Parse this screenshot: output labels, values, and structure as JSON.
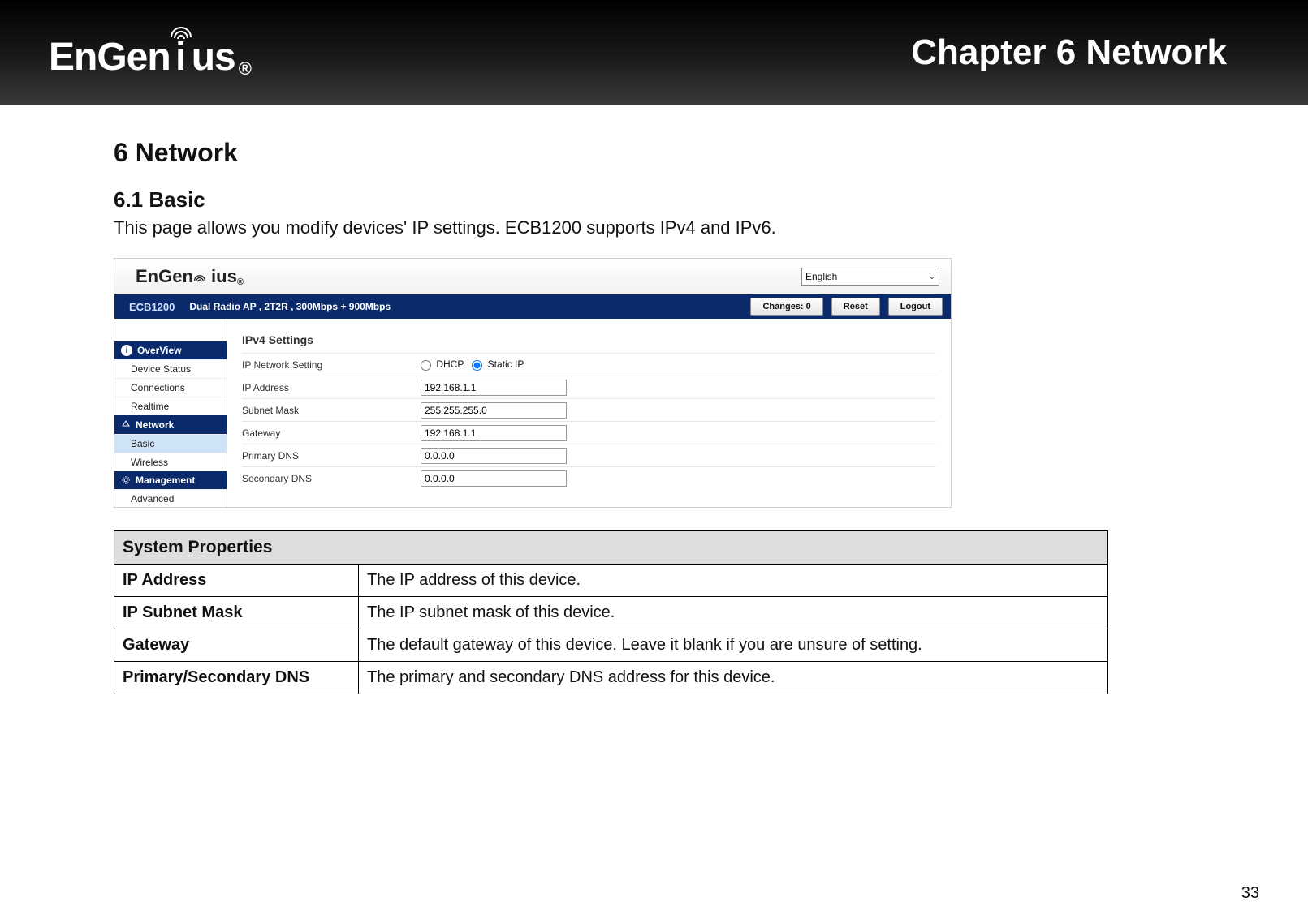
{
  "header": {
    "brand": "EnGenius",
    "registered": "®",
    "chapter_title": "Chapter 6 Network"
  },
  "doc": {
    "section_number_title": "6   Network",
    "subsection_title": "6.1   Basic",
    "lead_text": "This page allows you modify devices' IP settings. ECB1200 supports IPv4 and IPv6.",
    "page_number": "33"
  },
  "ui": {
    "brand": "EnGenius",
    "registered": "®",
    "language": "English",
    "model": "ECB1200",
    "model_desc": "Dual Radio AP , 2T2R , 300Mbps + 900Mbps",
    "changes_label": "Changes: 0",
    "reset_label": "Reset",
    "logout_label": "Logout",
    "sidebar": {
      "overview": "OverView",
      "items_overview": [
        "Device Status",
        "Connections",
        "Realtime"
      ],
      "network": "Network",
      "items_network": [
        "Basic",
        "Wireless"
      ],
      "management": "Management",
      "items_management": [
        "Advanced"
      ]
    },
    "panel": {
      "title": "IPv4 Settings",
      "rows": [
        {
          "label": "IP Network Setting",
          "type": "radio",
          "options": [
            "DHCP",
            "Static IP"
          ],
          "selected": "Static IP"
        },
        {
          "label": "IP Address",
          "type": "text",
          "value": "192.168.1.1"
        },
        {
          "label": "Subnet Mask",
          "type": "text",
          "value": "255.255.255.0"
        },
        {
          "label": "Gateway",
          "type": "text",
          "value": "192.168.1.1"
        },
        {
          "label": "Primary DNS",
          "type": "text",
          "value": "0.0.0.0"
        },
        {
          "label": "Secondary DNS",
          "type": "text",
          "value": "0.0.0.0"
        }
      ]
    }
  },
  "props_table": {
    "title": "System Properties",
    "rows": [
      {
        "k": "IP Address",
        "v": "The IP address of this device."
      },
      {
        "k": "IP Subnet Mask",
        "v": "The IP subnet mask of this device."
      },
      {
        "k": "Gateway",
        "v": "The default gateway of this device. Leave it blank if you are unsure of setting."
      },
      {
        "k": "Primary/Secondary DNS",
        "v": "The primary and secondary DNS address for this device."
      }
    ]
  }
}
